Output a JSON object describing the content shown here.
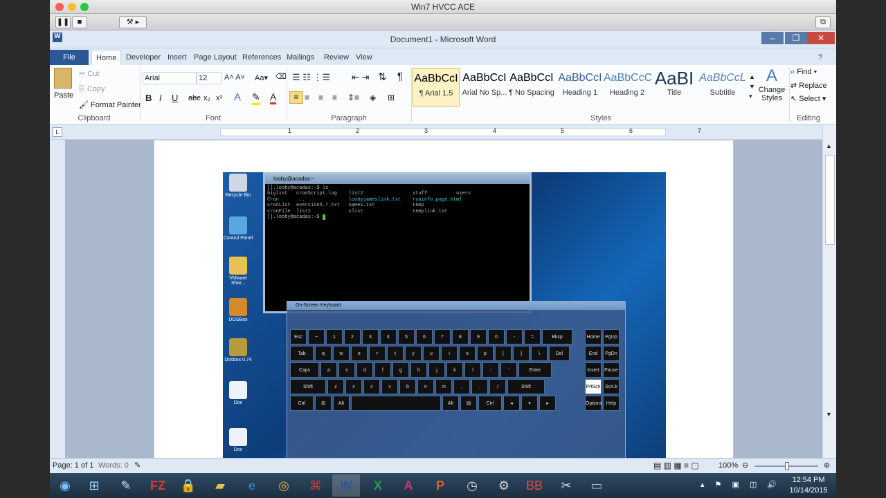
{
  "mac": {
    "window_title": "Win7 HVCC ACE"
  },
  "word": {
    "title": "Document1 - Microsoft Word",
    "tabs": [
      "File",
      "Home",
      "Developer",
      "Insert",
      "Page Layout",
      "References",
      "Mailings",
      "Review",
      "View"
    ],
    "clipboard": {
      "paste": "Paste",
      "cut": "Cut",
      "copy": "Copy",
      "format_painter": "Format Painter",
      "label": "Clipboard"
    },
    "font": {
      "name": "Arial",
      "size": "12",
      "label": "Font"
    },
    "paragraph": {
      "label": "Paragraph"
    },
    "styles": {
      "label": "Styles",
      "items": [
        {
          "preview": "AaBbCcI",
          "name": "¶ Arial 1.5"
        },
        {
          "preview": "AaBbCcI",
          "name": "Arial No Sp..."
        },
        {
          "preview": "AaBbCcI",
          "name": "¶ No Spacing"
        },
        {
          "preview": "AaBbCcI",
          "name": "Heading 1"
        },
        {
          "preview": "AaBbCcC",
          "name": "Heading 2"
        },
        {
          "preview": "AaBI",
          "name": "Title"
        },
        {
          "preview": "AaBbCcL",
          "name": "Subtitle"
        }
      ],
      "change": "Change Styles"
    },
    "editing": {
      "find": "Find",
      "replace": "Replace",
      "select": "Select",
      "label": "Editing"
    },
    "status": {
      "page": "Page: 1 of 1",
      "words": "Words: 0",
      "zoom": "100%"
    },
    "ruler_numbers": [
      "1",
      "2",
      "3",
      "4",
      "5",
      "6",
      "7"
    ]
  },
  "desktop": {
    "icons": [
      "Recycle Bin",
      "Control Panel",
      "VMware Shar...",
      "DOSBox",
      "Dosbox 0.74",
      "Doc",
      "Doc"
    ],
    "terminal": {
      "title": "looby@acadax:~",
      "lines": [
        "[].looby@acadax:~$ ls",
        "biglist   cronScript.log    list2                 stuff          users",
        "Cron      ...               loobyjameslink.txt    ryainfo_page.html",
        "cronList  exercise5.7.txt   names.txt             temp",
        "cronFile  list1             slist                 templink.txt",
        "[].looby@acadax:~$ "
      ]
    },
    "osk": {
      "title": "On-Screen Keyboard"
    }
  },
  "clock": {
    "time": "12:54 PM",
    "date": "10/14/2015"
  }
}
